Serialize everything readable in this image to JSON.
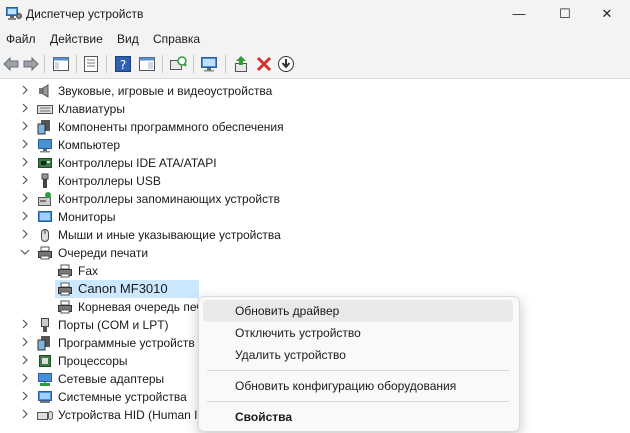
{
  "window": {
    "title": "Диспетчер устройств",
    "minimize_glyph": "—",
    "maximize_glyph": "☐",
    "close_glyph": "✕"
  },
  "menu": [
    "Файл",
    "Действие",
    "Вид",
    "Справка"
  ],
  "toolbar": {
    "icons": [
      "back-arrow-icon",
      "forward-arrow-icon",
      "properties-pane-icon",
      "show-hidden-icon",
      "help-icon",
      "action-pane-icon",
      "scan-hardware-icon",
      "monitor-icon",
      "update-driver-icon",
      "uninstall-icon",
      "download-icon"
    ]
  },
  "tree": {
    "items": [
      {
        "label": "Звуковые, игровые и видеоустройства",
        "icon": "speaker-icon",
        "expanded": false,
        "level": 0
      },
      {
        "label": "Клавиатуры",
        "icon": "keyboard-icon",
        "expanded": false,
        "level": 0
      },
      {
        "label": "Компоненты программного обеспечения",
        "icon": "software-component-icon",
        "expanded": false,
        "level": 0
      },
      {
        "label": "Компьютер",
        "icon": "computer-icon",
        "expanded": false,
        "level": 0
      },
      {
        "label": "Контроллеры IDE ATA/ATAPI",
        "icon": "ide-controller-icon",
        "expanded": false,
        "level": 0
      },
      {
        "label": "Контроллеры USB",
        "icon": "usb-icon",
        "expanded": false,
        "level": 0
      },
      {
        "label": "Контроллеры запоминающих устройств",
        "icon": "storage-controller-icon",
        "expanded": false,
        "level": 0
      },
      {
        "label": "Мониторы",
        "icon": "monitor-icon",
        "expanded": false,
        "level": 0
      },
      {
        "label": "Мыши и иные указывающие устройства",
        "icon": "mouse-icon",
        "expanded": false,
        "level": 0
      },
      {
        "label": "Очереди печати",
        "icon": "printer-icon",
        "expanded": true,
        "level": 0
      },
      {
        "label": "Fax",
        "icon": "printer-icon",
        "level": 1
      },
      {
        "label": "Canon MF3010",
        "icon": "printer-icon",
        "level": 1,
        "selected": true
      },
      {
        "label": "Корневая очередь печ",
        "icon": "printer-icon",
        "level": 1
      },
      {
        "label": "Порты (COM и LPT)",
        "icon": "port-icon",
        "expanded": false,
        "level": 0
      },
      {
        "label": "Программные устройств",
        "icon": "software-device-icon",
        "expanded": false,
        "level": 0
      },
      {
        "label": "Процессоры",
        "icon": "processor-icon",
        "expanded": false,
        "level": 0
      },
      {
        "label": "Сетевые адаптеры",
        "icon": "network-adapter-icon",
        "expanded": false,
        "level": 0
      },
      {
        "label": "Системные устройства",
        "icon": "system-device-icon",
        "expanded": false,
        "level": 0
      },
      {
        "label": "Устройства HID (Human I",
        "icon": "hid-icon",
        "expanded": false,
        "level": 0
      }
    ]
  },
  "context_menu": {
    "update_driver": "Обновить драйвер",
    "disable_device": "Отключить устройство",
    "uninstall_device": "Удалить устройство",
    "scan_hardware": "Обновить конфигурацию оборудования",
    "properties": "Свойства"
  },
  "colors": {
    "selection": "#cce8ff",
    "chrome": "#f3f3f3",
    "uninstall_red": "#d32f2f",
    "update_green": "#2e9d3a"
  }
}
